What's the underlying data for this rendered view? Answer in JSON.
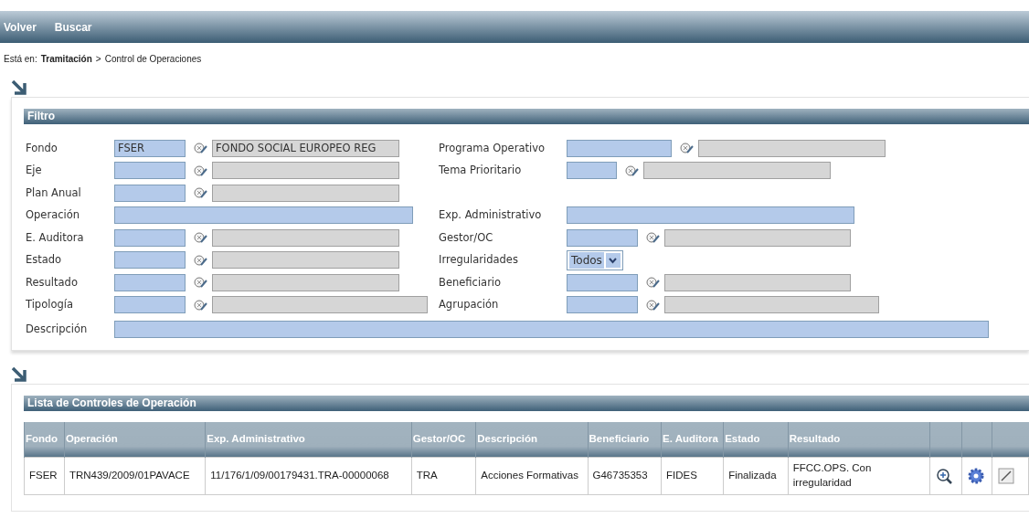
{
  "toolbar": {
    "buttons": [
      "Volver",
      "Buscar"
    ]
  },
  "breadcrumb": {
    "prefix": "Está en:",
    "link": "Tramitación",
    "separator": ">",
    "current": "Control de Operaciones"
  },
  "filter": {
    "title": "Filtro",
    "rows": [
      {
        "left": {
          "label": "Fondo",
          "kind": "lookup",
          "code": "FSER",
          "description": "FONDO SOCIAL EUROPEO REG"
        },
        "right": {
          "label": "Programa Operativo",
          "kind": "lookup"
        }
      },
      {
        "left": {
          "label": "Eje",
          "kind": "lookup"
        },
        "right": {
          "label": "Tema Prioritario",
          "kind": "lookup"
        }
      },
      {
        "left": {
          "label": "Plan Anual",
          "kind": "lookup"
        }
      },
      {
        "left": {
          "label": "Operación",
          "kind": "text"
        },
        "right": {
          "label": "Exp. Administrativo",
          "kind": "text"
        }
      },
      {
        "left": {
          "label": "E. Auditora",
          "kind": "lookup"
        },
        "right": {
          "label": "Gestor/OC",
          "kind": "lookup"
        }
      },
      {
        "left": {
          "label": "Estado",
          "kind": "lookup"
        },
        "right": {
          "label": "Irregularidades",
          "kind": "select",
          "value": "Todos"
        }
      },
      {
        "left": {
          "label": "Resultado",
          "kind": "lookup"
        },
        "right": {
          "label": "Beneficiario",
          "kind": "lookup"
        }
      },
      {
        "left": {
          "label": "Tipología",
          "kind": "lookup"
        },
        "right": {
          "label": "Agrupación",
          "kind": "lookup"
        }
      }
    ],
    "description_label": "Descripción"
  },
  "list": {
    "title": "Lista de Controles de Operación",
    "columns": [
      "Fondo",
      "Operación",
      "Exp. Administrativo",
      "Gestor/OC",
      "Descripción",
      "Beneficiario",
      "E. Auditora",
      "Estado",
      "Resultado"
    ],
    "rows": [
      {
        "cells": [
          "FSER",
          "TRN439/2009/01PAVACE",
          "11/176/1/09/00179431.TRA-00000068",
          "TRA",
          "Acciones Formativas",
          "G46735353",
          "FIDES",
          "Finalizada",
          "FFCC.OPS. Con irregularidad"
        ]
      }
    ]
  }
}
